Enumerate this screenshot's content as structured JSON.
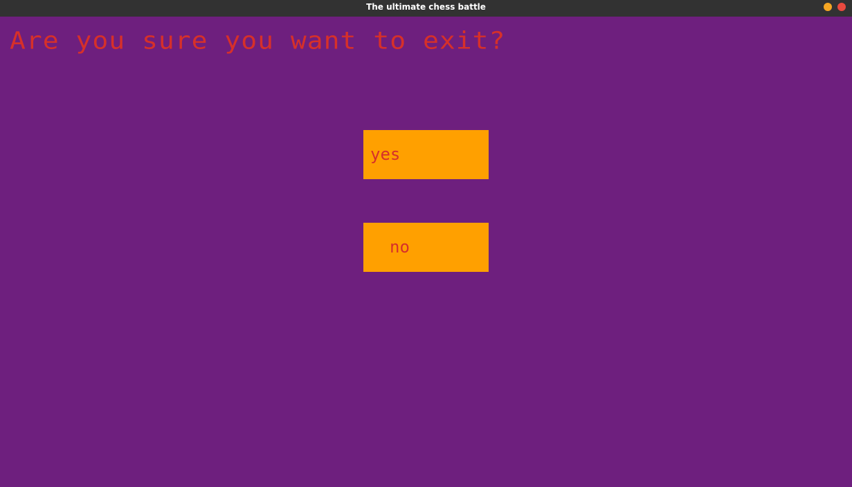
{
  "window": {
    "title": "The ultimate chess battle",
    "controls": [
      "minimize",
      "close"
    ]
  },
  "dialog": {
    "question": "Are you sure you want to exit?",
    "yes_label": "yes",
    "no_label": "no"
  },
  "colors": {
    "background": "#6e1f7e",
    "button": "#ffa000",
    "text": "#d6302a",
    "titlebar": "#323232"
  }
}
